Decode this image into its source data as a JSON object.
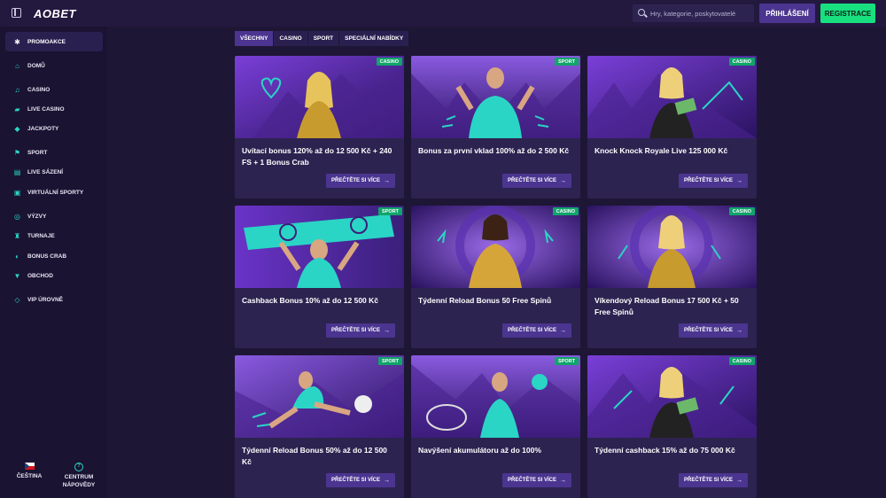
{
  "header": {
    "logo": "AOBET",
    "search_placeholder": "Hry, kategorie, poskytovatelé",
    "login_label": "PŘIHLÁŠENÍ",
    "register_label": "REGISTRACE"
  },
  "sidebar": {
    "items": [
      {
        "label": "PROMOAKCE",
        "icon": "promo-icon"
      },
      {
        "label": "DOMŮ",
        "icon": "home-icon"
      },
      {
        "label": "CASINO",
        "icon": "music-note-icon"
      },
      {
        "label": "LIVE CASINO",
        "icon": "cards-icon"
      },
      {
        "label": "JACKPOTY",
        "icon": "diamond-icon"
      },
      {
        "label": "SPORT",
        "icon": "sport-icon"
      },
      {
        "label": "LIVE SÁZENÍ",
        "icon": "live-betting-icon"
      },
      {
        "label": "VIRTUÁLNÍ SPORTY",
        "icon": "virtual-sports-icon"
      },
      {
        "label": "VÝZVY",
        "icon": "medal-icon"
      },
      {
        "label": "TURNAJE",
        "icon": "trophy-icon"
      },
      {
        "label": "BONUS CRAB",
        "icon": "crab-icon"
      },
      {
        "label": "OBCHOD",
        "icon": "shop-icon"
      },
      {
        "label": "VIP ÚROVNĚ",
        "icon": "vip-diamond-icon"
      }
    ],
    "footer": {
      "language": "ČEŠTINA",
      "help_line1": "CENTRUM",
      "help_line2": "NÁPOVĚDY"
    }
  },
  "tabs": [
    "VŠECHNY",
    "CASINO",
    "SPORT",
    "SPECIÁLNÍ NABÍDKY"
  ],
  "cards": [
    {
      "badge": "CASINO",
      "title": "Uvítací bonus 120% až do 12 500 Kč + 240 FS + 1 Bonus Crab",
      "button": "PŘEČTĚTE SI VÍCE"
    },
    {
      "badge": "SPORT",
      "title": "Bonus za první vklad 100% až do 2 500 Kč",
      "button": "PŘEČTĚTE SI VÍCE"
    },
    {
      "badge": "CASINO",
      "title": "Knock Knock Royale Live 125 000 Kč",
      "button": "PŘEČTĚTE SI VÍCE"
    },
    {
      "badge": "SPORT",
      "title": "Cashback Bonus 10% až do 12 500 Kč",
      "button": "PŘEČTĚTE SI VÍCE"
    },
    {
      "badge": "CASINO",
      "title": "Týdenní Reload Bonus 50 Free Spinů",
      "button": "PŘEČTĚTE SI VÍCE"
    },
    {
      "badge": "CASINO",
      "title": "Víkendový Reload Bonus 17 500 Kč + 50 Free Spinů",
      "button": "PŘEČTĚTE SI VÍCE"
    },
    {
      "badge": "SPORT",
      "title": "Týdenní Reload Bonus 50% až do 12 500 Kč",
      "button": "PŘEČTĚTE SI VÍCE"
    },
    {
      "badge": "SPORT",
      "title": "Navýšení akumulátoru až do 100%",
      "button": "PŘEČTĚTE SI VÍCE"
    },
    {
      "badge": "CASINO",
      "title": "Týdenní cashback 15% až do 75 000 Kč",
      "button": "PŘEČTĚTE SI VÍCE"
    }
  ],
  "colors": {
    "accent": "#4b3590",
    "register": "#18e07f",
    "badge": "#10a56a",
    "icon": "#2ad5c5"
  }
}
